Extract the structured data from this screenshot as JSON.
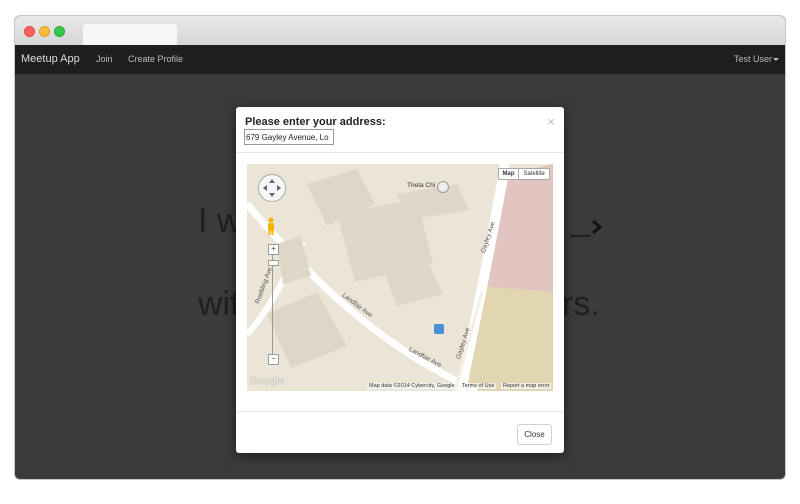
{
  "browser": {
    "tab_label": ""
  },
  "navbar": {
    "brand": "Meetup App",
    "links": [
      "Join",
      "Create Profile"
    ],
    "user_menu": "Test User"
  },
  "background": {
    "line1_left": "I w",
    "line1_right": "_",
    "line2_left": "wit",
    "line2_right": "rs."
  },
  "modal": {
    "title": "Please enter your address:",
    "address_value": "679 Gayley Avenue, Lo",
    "close_x": "×",
    "close_button": "Close"
  },
  "map": {
    "type_controls": [
      "Map",
      "Satellite"
    ],
    "active_type": "Map",
    "place_label": "Theta Chi",
    "streets": [
      "Landfair Ave",
      "Landfair Ave",
      "Gayley Ave",
      "Gayley Ave",
      "Roebling Ave"
    ],
    "logo": "Google",
    "attribution": {
      "data": "Map data ©2014 Cybercity, Google",
      "terms": "Terms of Use",
      "report": "Report a map error"
    },
    "zoom_in": "+",
    "zoom_out": "−",
    "colors": {
      "pink_zone": "#e2c4c0",
      "sand_zone": "#e2d6b0",
      "road": "#ffffff",
      "building": "#ded7c7"
    }
  }
}
